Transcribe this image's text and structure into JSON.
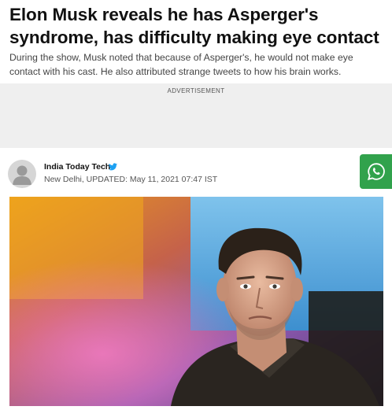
{
  "article": {
    "headline": "Elon Musk reveals he has Asperger's syndrome, has difficulty making eye contact",
    "summary": "During the show, Musk noted that because of Asperger's, he would not make eye contact with his cast. He also attributed strange tweets to how his brain works."
  },
  "ad": {
    "label": "ADVERTISEMENT"
  },
  "byline": {
    "author": "India Today Tech",
    "verified_icon": "twitter-bird-icon",
    "dateline": "New Delhi, UPDATED: May 11, 2021 07:47 IST"
  },
  "share": {
    "icon": "whatsapp-icon",
    "color": "#31a24c"
  },
  "photo": {
    "subject": "portrait"
  }
}
